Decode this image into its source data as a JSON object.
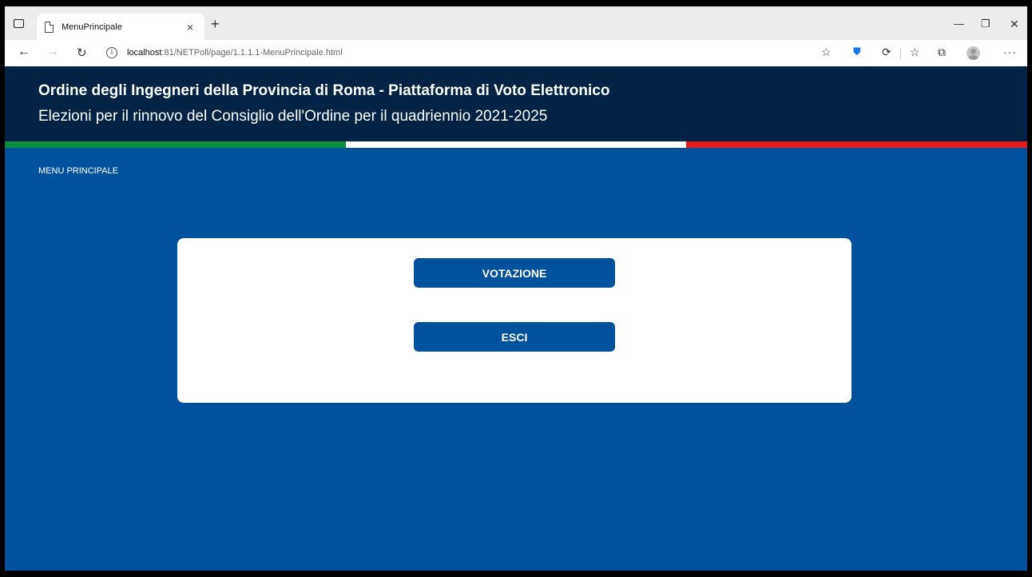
{
  "browser": {
    "tab_title": "MenuPrincipale",
    "tab_close": "×",
    "new_tab": "+",
    "url_host": "localhost",
    "url_rest": ":81/NETPoll/page/1.1.1.1-MenuPrincipale.html",
    "window_controls": {
      "minimize": "—",
      "restore": "❐",
      "close": "✕"
    },
    "nav": {
      "back": "←",
      "forward": "→",
      "reload": "↻"
    },
    "icons": [
      "tab-actions-icon",
      "page-icon",
      "info-icon",
      "favorite-star-icon",
      "shield-icon",
      "extensions-icon",
      "favorites-icon",
      "collections-icon",
      "profile-avatar-icon",
      "more-icon"
    ]
  },
  "header": {
    "title": "Ordine degli Ingegneri della Provincia di Roma - Piattaforma di Voto Elettronico",
    "subtitle": "Elezioni per il rinnovo del Consiglio dell'Ordine per il quadriennio 2021-2025"
  },
  "breadcrumb": "MENU PRINCIPALE",
  "menu": {
    "vote_label": "VOTAZIONE",
    "exit_label": "ESCI"
  },
  "colors": {
    "page_bg": "#01519c",
    "header_bg": "#022345",
    "flag_green": "#0a8f3a",
    "flag_white": "#ffffff",
    "flag_red": "#e41a1a"
  }
}
